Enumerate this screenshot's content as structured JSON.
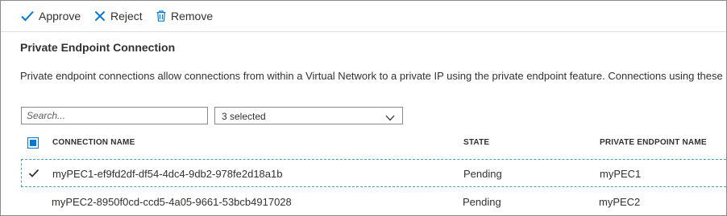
{
  "toolbar": {
    "approve_label": "Approve",
    "reject_label": "Reject",
    "remove_label": "Remove"
  },
  "section": {
    "title": "Private Endpoint Connection",
    "description": "Private endpoint connections allow connections from within a Virtual Network to a private IP using the private endpoint feature. Connections using these"
  },
  "search": {
    "placeholder": "Search..."
  },
  "filter": {
    "value": "3 selected"
  },
  "table": {
    "headers": {
      "connection_name": "CONNECTION NAME",
      "state": "STATE",
      "private_endpoint_name": "PRIVATE ENDPOINT NAME"
    },
    "rows": [
      {
        "connection_name": "myPEC1-ef9fd2df-df54-4dc4-9db2-978fe2d18a1b",
        "state": "Pending",
        "private_endpoint_name": "myPEC1",
        "selected": true
      },
      {
        "connection_name": "myPEC2-8950f0cd-ccd5-4a05-9661-53bcb4917028",
        "state": "Pending",
        "private_endpoint_name": "myPEC2",
        "selected": false
      }
    ]
  },
  "colors": {
    "accent": "#0078d4",
    "text": "#323130",
    "selection_border": "#4aa0b8"
  },
  "icons": {
    "approve": "checkmark-icon",
    "reject": "x-icon",
    "remove": "trash-icon",
    "dropdown": "chevron-down-icon"
  }
}
